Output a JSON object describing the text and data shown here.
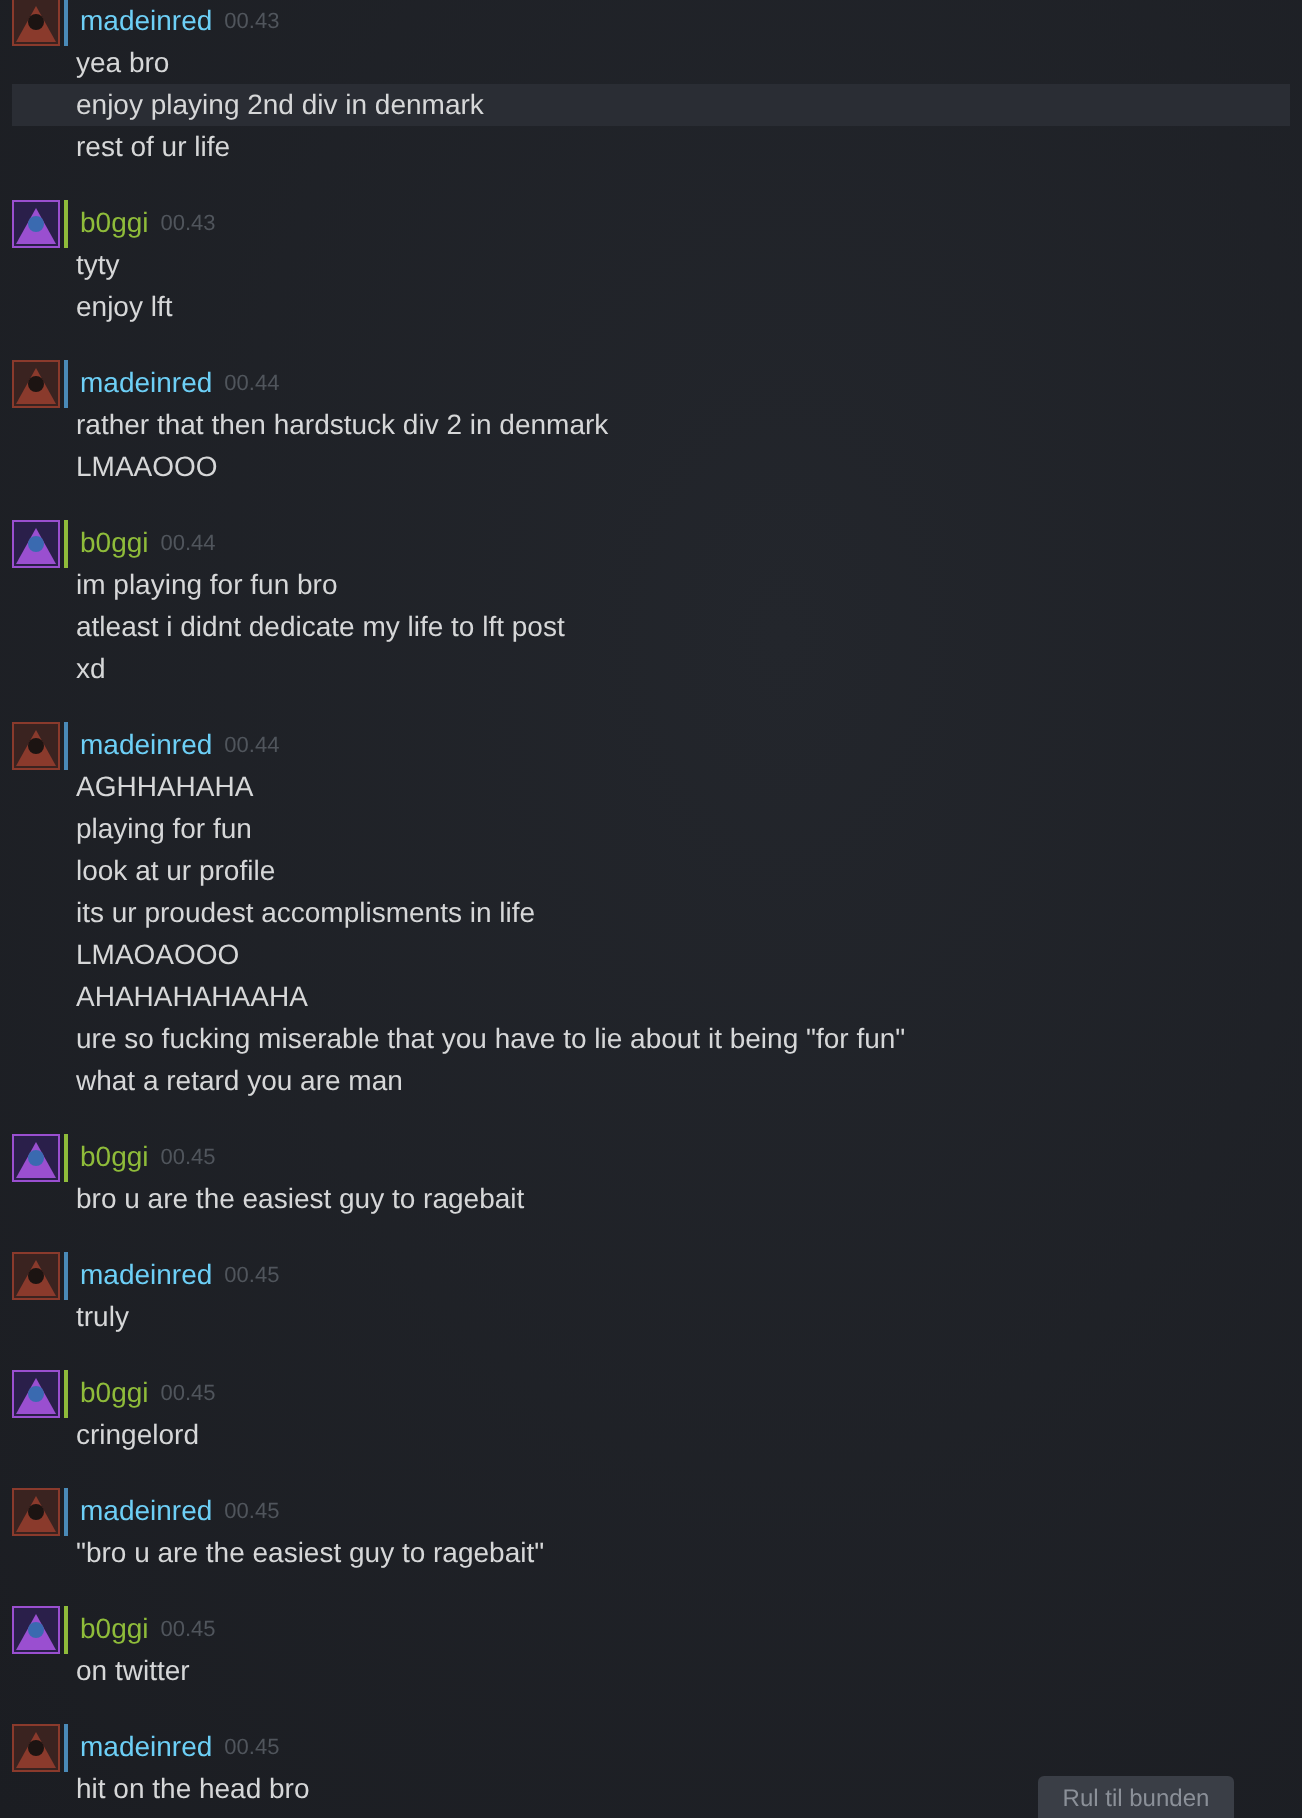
{
  "messages": [
    {
      "sender": "madeinred",
      "color": "#6dcff6",
      "time": "00.43",
      "kind": "crimson",
      "lines": [
        {
          "text": "yea bro",
          "highlighted": false
        },
        {
          "text": "enjoy playing 2nd div in denmark",
          "highlighted": true
        },
        {
          "text": "rest of ur life",
          "highlighted": false
        }
      ]
    },
    {
      "sender": "b0ggi",
      "color": "#8fbc3a",
      "time": "00.43",
      "kind": "violet",
      "lines": [
        {
          "text": "tyty",
          "highlighted": false
        },
        {
          "text": "enjoy lft",
          "highlighted": false
        }
      ]
    },
    {
      "sender": "madeinred",
      "color": "#6dcff6",
      "time": "00.44",
      "kind": "crimson",
      "lines": [
        {
          "text": "rather that then hardstuck div 2 in denmark",
          "highlighted": false
        },
        {
          "text": "LMAAOOO",
          "highlighted": false
        }
      ]
    },
    {
      "sender": "b0ggi",
      "color": "#8fbc3a",
      "time": "00.44",
      "kind": "violet",
      "lines": [
        {
          "text": "im playing for fun bro",
          "highlighted": false
        },
        {
          "text": "atleast i didnt dedicate my life to lft post",
          "highlighted": false
        },
        {
          "text": "xd",
          "highlighted": false
        }
      ]
    },
    {
      "sender": "madeinred",
      "color": "#6dcff6",
      "time": "00.44",
      "kind": "crimson",
      "lines": [
        {
          "text": "AGHHAHAHA",
          "highlighted": false
        },
        {
          "text": "playing for fun",
          "highlighted": false
        },
        {
          "text": "look at ur profile",
          "highlighted": false
        },
        {
          "text": "its ur proudest accomplisments in life",
          "highlighted": false
        },
        {
          "text": "LMAOAOOO",
          "highlighted": false
        },
        {
          "text": "AHAHAHAHAAHA",
          "highlighted": false
        },
        {
          "text": "ure so fucking miserable that you have to lie about it being \"for fun\"",
          "highlighted": false
        },
        {
          "text": "what a retard you are man",
          "highlighted": false
        }
      ]
    },
    {
      "sender": "b0ggi",
      "color": "#8fbc3a",
      "time": "00.45",
      "kind": "violet",
      "lines": [
        {
          "text": "bro u are the easiest guy to ragebait",
          "highlighted": false
        }
      ]
    },
    {
      "sender": "madeinred",
      "color": "#6dcff6",
      "time": "00.45",
      "kind": "crimson",
      "lines": [
        {
          "text": "truly",
          "highlighted": false
        }
      ]
    },
    {
      "sender": "b0ggi",
      "color": "#8fbc3a",
      "time": "00.45",
      "kind": "violet",
      "lines": [
        {
          "text": "cringelord",
          "highlighted": false
        }
      ]
    },
    {
      "sender": "madeinred",
      "color": "#6dcff6",
      "time": "00.45",
      "kind": "crimson",
      "lines": [
        {
          "text": "\"bro u are the easiest guy to ragebait\"",
          "highlighted": false
        }
      ]
    },
    {
      "sender": "b0ggi",
      "color": "#8fbc3a",
      "time": "00.45",
      "kind": "violet",
      "lines": [
        {
          "text": "on twitter",
          "highlighted": false
        }
      ]
    },
    {
      "sender": "madeinred",
      "color": "#6dcff6",
      "time": "00.45",
      "kind": "crimson",
      "lines": [
        {
          "text": "hit on the head bro",
          "highlighted": false
        }
      ]
    }
  ],
  "scroll_button": "Rul til bunden"
}
